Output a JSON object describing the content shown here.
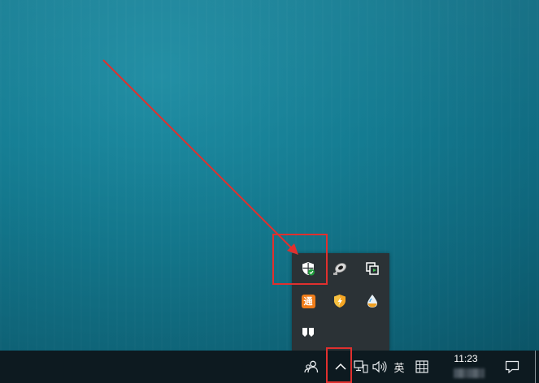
{
  "taskbar": {
    "time": "11:23",
    "input_method": "英",
    "icons": [
      "people-icon",
      "show-hidden-icons-chevron",
      "network-icon",
      "volume-icon",
      "input-method-indicator",
      "ime-grid-icon",
      "notification-icon"
    ]
  },
  "tray_popup": {
    "icons": [
      "windows-security-icon",
      "satellite-dish-icon",
      "copy-window-icon",
      "tong-app-icon",
      "orange-shield-icon",
      "droplet-icon",
      "bookmark-app-icon"
    ],
    "tong_app_glyph": "通"
  },
  "annotations": {
    "color": "#e0302e"
  }
}
